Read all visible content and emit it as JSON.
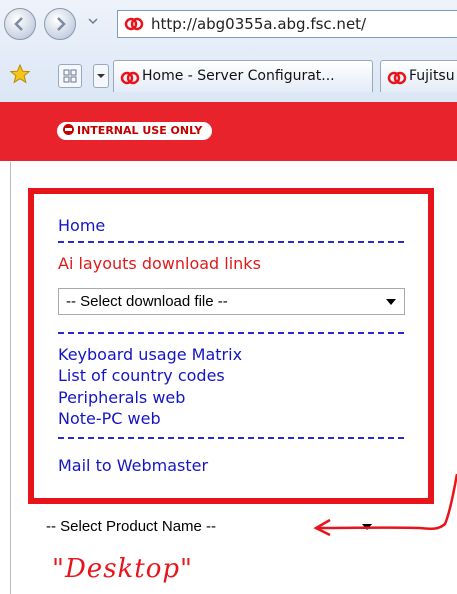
{
  "browser": {
    "url": "http://abg0355a.abg.fsc.net/",
    "tabs": [
      {
        "label": "Home - Server Configurat..."
      },
      {
        "label": "Fujitsu"
      }
    ]
  },
  "banner": {
    "badge": "INTERNAL USE ONLY",
    "color": "#e8232b"
  },
  "nav": {
    "home": "Home",
    "ai_heading": "Ai layouts download links",
    "download_select": "-- Select download file --",
    "links": [
      "Keyboard usage Matrix",
      "List of country codes",
      "Peripherals web",
      "Note-PC web"
    ],
    "mail": "Mail to Webmaster"
  },
  "product_select": "-- Select Product Name --",
  "annotation": {
    "note": "\"Desktop\"",
    "color": "#e8141b"
  },
  "icons": [
    "back-icon",
    "forward-icon",
    "favorites-star-icon",
    "quick-tabs-icon",
    "site-icon",
    "no-entry-icon"
  ]
}
